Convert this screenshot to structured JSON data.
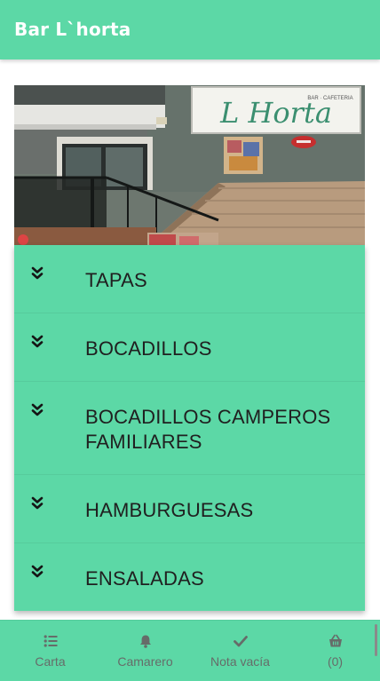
{
  "app": {
    "title": "Bar L`horta",
    "accent_color": "#5cd8a6"
  },
  "hero": {
    "description": "Photo of the bar facade",
    "sign_text": "L Horta",
    "sign_subtext": "BAR · CAFETERIA"
  },
  "menu": {
    "items": [
      {
        "label": "TAPAS",
        "icon": "chevron-double-down-icon"
      },
      {
        "label": "BOCADILLOS",
        "icon": "chevron-double-down-icon"
      },
      {
        "label": "BOCADILLOS CAMPEROS FAMILIARES",
        "icon": "chevron-double-down-icon"
      },
      {
        "label": "HAMBURGUESAS",
        "icon": "chevron-double-down-icon"
      },
      {
        "label": "ENSALADAS",
        "icon": "chevron-double-down-icon"
      }
    ]
  },
  "bottom_nav": {
    "carta": {
      "label": "Carta",
      "icon": "list-icon"
    },
    "camarero": {
      "label": "Camarero",
      "icon": "bell-icon"
    },
    "nota": {
      "label": "Nota vacía",
      "icon": "check-icon"
    },
    "basket": {
      "label": "(0)",
      "icon": "basket-icon"
    }
  }
}
